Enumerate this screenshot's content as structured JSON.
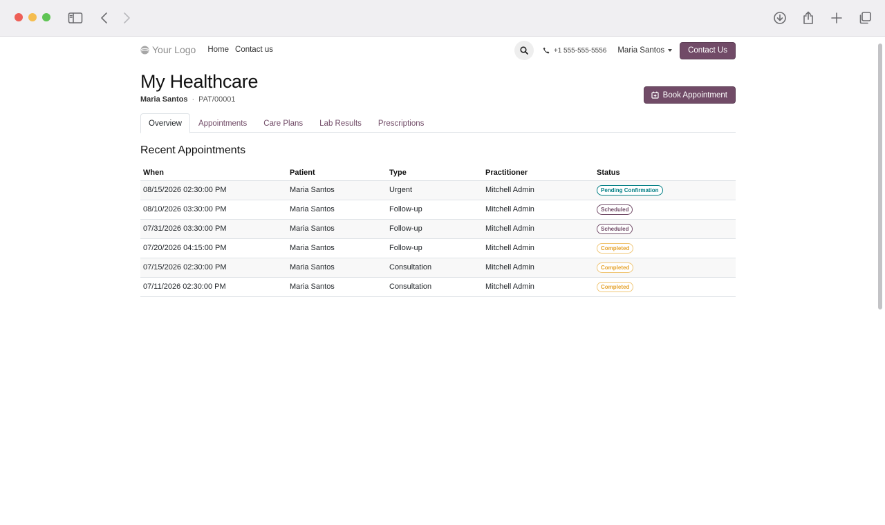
{
  "navbar": {
    "logo_text": "Your Logo",
    "links": [
      "Home",
      "Contact us"
    ],
    "phone": "+1 555-555-5556",
    "user": "Maria Santos",
    "contact_button": "Contact Us"
  },
  "header": {
    "title": "My Healthcare",
    "patient_name": "Maria Santos",
    "separator": "·",
    "patient_id": "PAT/00001",
    "book_button": "Book Appointment"
  },
  "tabs": [
    {
      "label": "Overview",
      "active": true
    },
    {
      "label": "Appointments",
      "active": false
    },
    {
      "label": "Care Plans",
      "active": false
    },
    {
      "label": "Lab Results",
      "active": false
    },
    {
      "label": "Prescriptions",
      "active": false
    }
  ],
  "recent": {
    "title": "Recent Appointments",
    "columns": [
      "When",
      "Patient",
      "Type",
      "Practitioner",
      "Status"
    ],
    "rows": [
      {
        "when": "08/15/2026 02:30:00 PM",
        "patient": "Maria Santos",
        "type": "Urgent",
        "practitioner": "Mitchell Admin",
        "status": "Pending Confirmation",
        "status_kind": "pending"
      },
      {
        "when": "08/10/2026 03:30:00 PM",
        "patient": "Maria Santos",
        "type": "Follow-up",
        "practitioner": "Mitchell Admin",
        "status": "Scheduled",
        "status_kind": "scheduled"
      },
      {
        "when": "07/31/2026 03:30:00 PM",
        "patient": "Maria Santos",
        "type": "Follow-up",
        "practitioner": "Mitchell Admin",
        "status": "Scheduled",
        "status_kind": "scheduled"
      },
      {
        "when": "07/20/2026 04:15:00 PM",
        "patient": "Maria Santos",
        "type": "Follow-up",
        "practitioner": "Mitchell Admin",
        "status": "Completed",
        "status_kind": "completed"
      },
      {
        "when": "07/15/2026 02:30:00 PM",
        "patient": "Maria Santos",
        "type": "Consultation",
        "practitioner": "Mitchell Admin",
        "status": "Completed",
        "status_kind": "completed"
      },
      {
        "when": "07/11/2026 02:30:00 PM",
        "patient": "Maria Santos",
        "type": "Consultation",
        "practitioner": "Mitchell Admin",
        "status": "Completed",
        "status_kind": "completed"
      }
    ]
  },
  "colors": {
    "brand": "#714b67",
    "pending": "#017e84",
    "completed": "#e5a32d"
  }
}
